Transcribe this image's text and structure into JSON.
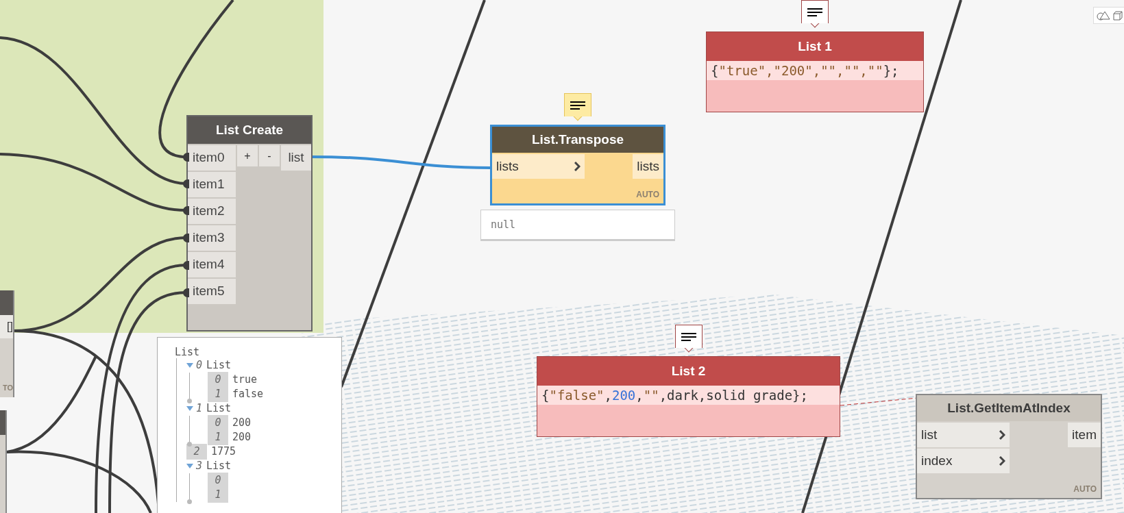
{
  "list_create": {
    "title": "List Create",
    "inputs": [
      "item0",
      "item1",
      "item2",
      "item3",
      "item4",
      "item5"
    ],
    "add_label": "+",
    "remove_label": "-",
    "output": "list"
  },
  "partial_node": {
    "port": "[]",
    "footer": "TO"
  },
  "watch": {
    "root": "List",
    "items": [
      {
        "index": "0",
        "label": "List",
        "expanded": true,
        "children": [
          {
            "index": "0",
            "label": "true"
          },
          {
            "index": "1",
            "label": "false"
          }
        ]
      },
      {
        "index": "1",
        "label": "List",
        "expanded": true,
        "children": [
          {
            "index": "0",
            "label": "200"
          },
          {
            "index": "1",
            "label": "200"
          }
        ]
      },
      {
        "index": "2",
        "label": "1775"
      },
      {
        "index": "3",
        "label": "List",
        "expanded": true,
        "children": [
          {
            "index": "0"
          },
          {
            "index": "1"
          }
        ]
      }
    ]
  },
  "function_nodes": [
    {
      "title": "List.Transpose",
      "selected": true,
      "warning": true,
      "inputs": [
        "lists"
      ],
      "output": "lists",
      "lacing": "AUTO",
      "preview": "null"
    },
    {
      "title": "List.GetItemAtIndex",
      "selected": false,
      "warning": false,
      "inputs": [
        "list",
        "index"
      ],
      "output": "item",
      "lacing": "AUTO"
    }
  ],
  "code_blocks": [
    {
      "title": "List 1",
      "error": true,
      "tokens": [
        {
          "kind": "plain",
          "text": "{"
        },
        {
          "kind": "string",
          "text": "\"true\",\"200\",\"\",\"\",\"\""
        },
        {
          "kind": "plain",
          "text": "};"
        }
      ]
    },
    {
      "title": "List 2",
      "error": true,
      "tokens": [
        {
          "kind": "plain",
          "text": "{"
        },
        {
          "kind": "string",
          "text": "\"false\""
        },
        {
          "kind": "plain",
          "text": ","
        },
        {
          "kind": "number",
          "text": "200"
        },
        {
          "kind": "plain",
          "text": ","
        },
        {
          "kind": "string",
          "text": "\"\""
        },
        {
          "kind": "plain",
          "text": ",dark,solid grade};"
        }
      ]
    }
  ]
}
